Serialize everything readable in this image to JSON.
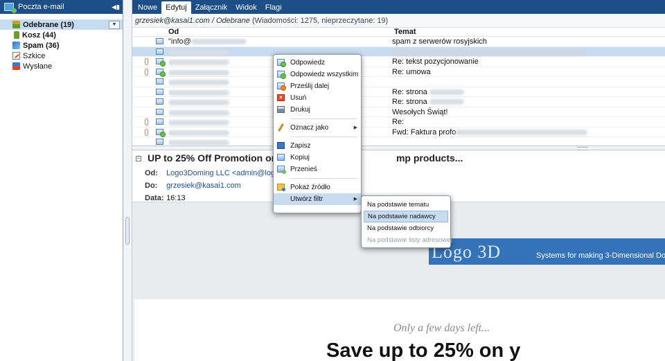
{
  "sidebar": {
    "title": "Poczta e-mail",
    "folders": [
      {
        "label": "Odebrane (19)",
        "icon": "inbox-icon",
        "selected": true,
        "bold": true
      },
      {
        "label": "Kosz (44)",
        "icon": "trash-icon",
        "bold": true
      },
      {
        "label": "Spam (36)",
        "icon": "spam-icon",
        "bold": true
      },
      {
        "label": "Szkice",
        "icon": "drafts-icon",
        "bold": false
      },
      {
        "label": "Wysłane",
        "icon": "sent-icon",
        "bold": false
      }
    ]
  },
  "menubar": {
    "items": [
      "Nowe",
      "Edytuj",
      "Załącznik",
      "Widok",
      "Flagi"
    ],
    "active": "Edytuj"
  },
  "path": {
    "account": "grzesiek@kasai1.com",
    "separator": "/",
    "folder": "Odebrane",
    "counts": "(Wiadomości: 1275, nieprzeczytane: 19)"
  },
  "message_list": {
    "columns": {
      "from": "Od",
      "subject": "Temat"
    },
    "rows": [
      {
        "from": "\"info@",
        "from_blurred": true,
        "subject": "spam z serwerów rosyjskich",
        "attach": false,
        "reply": false
      },
      {
        "from": "",
        "from_blurred": true,
        "subject": "",
        "subject_blurred": true,
        "attach": false,
        "reply": false,
        "selected": true
      },
      {
        "from": "",
        "from_blurred": true,
        "subject": "Re: tekst pozycjonowanie",
        "attach": true,
        "reply": true
      },
      {
        "from": "",
        "from_blurred": true,
        "subject": "Re: umowa",
        "attach": true,
        "reply": true
      },
      {
        "from": "",
        "from_blurred": true,
        "subject": "",
        "attach": false,
        "reply": false
      },
      {
        "from": "",
        "from_blurred": true,
        "subject": "Re: strona",
        "subject_blurred_tail": true,
        "attach": false,
        "reply": false
      },
      {
        "from": "",
        "from_blurred": true,
        "subject": "Re: strona",
        "subject_blurred_tail": true,
        "attach": false,
        "reply": false
      },
      {
        "from": "",
        "from_blurred": true,
        "subject": "Wesołych Świąt!",
        "attach": false,
        "reply": false
      },
      {
        "from": "",
        "from_blurred": true,
        "subject": "Re:",
        "attach": true,
        "reply": false
      },
      {
        "from": "",
        "from_blurred": true,
        "subject": "Fwd: Faktura profo",
        "subject_blurred_tail": true,
        "attach": true,
        "reply": true
      },
      {
        "from": "",
        "from_blurred": true,
        "subject": "",
        "attach": false,
        "reply": false
      }
    ]
  },
  "preview": {
    "subject": "UP to 25% Off Promotion on 3D",
    "subject_tail": "mp products...",
    "from_label": "Od:",
    "from_value": "Logo3Doming LLC <admin@logo3d",
    "to_label": "Do:",
    "to_value": "grzesiek@kasai1.com",
    "date_label": "Data:",
    "date_value": "16:13"
  },
  "email_body": {
    "logo": "Logo 3D",
    "tagline": "Systems for making 3-Dimensional Dor",
    "promo_tag": "Only a few days left...",
    "promo_headline": "Save up to 25% on y"
  },
  "context_menu": {
    "items": [
      {
        "label": "Odpowiedz",
        "icon": "reply-icon"
      },
      {
        "label": "Odpowiedz wszystkim",
        "icon": "reply-all-icon"
      },
      {
        "label": "Prześlij dalej",
        "icon": "forward-icon"
      },
      {
        "label": "Usuń",
        "icon": "delete-icon"
      },
      {
        "label": "Drukuj",
        "icon": "print-icon"
      },
      {
        "label": "Oznacz jako",
        "icon": "mark-icon",
        "submenu": true
      },
      {
        "label": "Zapisz",
        "icon": "save-icon"
      },
      {
        "label": "Kopiuj",
        "icon": "copy-icon"
      },
      {
        "label": "Przenieś",
        "icon": "move-icon"
      },
      {
        "label": "Pokaż źródło",
        "icon": "source-icon"
      },
      {
        "label": "Utwórz filtr",
        "icon": "",
        "submenu": true,
        "highlighted": true
      }
    ]
  },
  "filter_submenu": {
    "items": [
      {
        "label": "Na podstawie tematu",
        "state": "normal"
      },
      {
        "label": "Na podstawie nadawcy",
        "state": "highlighted"
      },
      {
        "label": "Na podstawie odbiorcy",
        "state": "normal"
      },
      {
        "label": "Na podstawie listy adresowej",
        "state": "disabled"
      }
    ]
  },
  "colors": {
    "header_bar": "#1d4f86",
    "selection": "#c7dbf1",
    "banner": "#3573b8"
  }
}
